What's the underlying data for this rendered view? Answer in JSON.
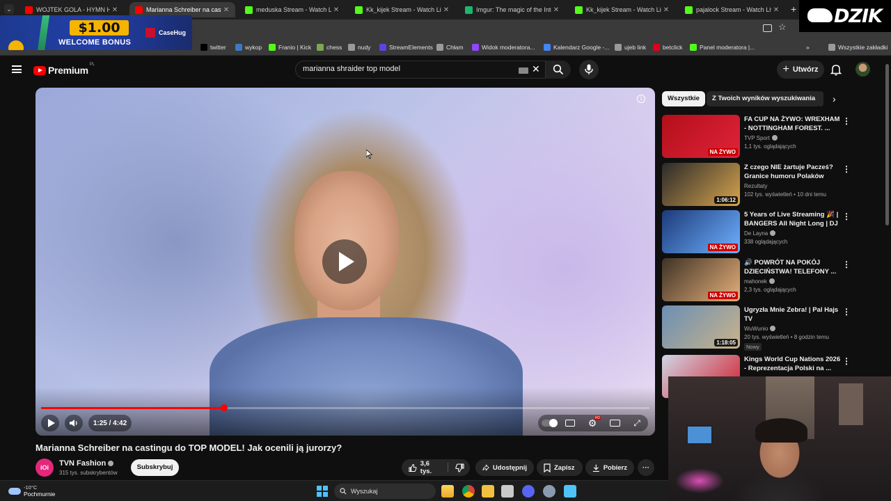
{
  "browser": {
    "tabs": [
      {
        "title": "WOJTEK GOLA - HYMN HETERO",
        "color": "#ff0000"
      },
      {
        "title": "Marianna Schreiber na castingu",
        "color": "#ff0000",
        "active": true
      },
      {
        "title": "meduska Stream - Watch Live on",
        "color": "#53fc18"
      },
      {
        "title": "Kk_kijek Stream - Watch Live on",
        "color": "#53fc18"
      },
      {
        "title": "Imgur: The magic of the Internet",
        "color": "#1bb76e"
      },
      {
        "title": "Kk_kijek Stream - Watch Live on",
        "color": "#53fc18"
      },
      {
        "title": "pajalock Stream - Watch Live on",
        "color": "#53fc18"
      }
    ],
    "new_tab_label": "+",
    "bookmarks": [
      {
        "label": "twitter",
        "icon": "x-icon",
        "color": "#000000"
      },
      {
        "label": "wykop",
        "icon": "wykop-icon",
        "color": "#3b7ac2"
      },
      {
        "label": "Franio | Kick",
        "icon": "kick-icon",
        "color": "#53fc18"
      },
      {
        "label": "chess",
        "icon": "chess-icon",
        "color": "#7fa650"
      },
      {
        "label": "nudy",
        "icon": "folder-icon",
        "color": "#9a9a9a"
      },
      {
        "label": "StreamElements",
        "icon": "streamelements-icon",
        "color": "#5945e2"
      },
      {
        "label": "Chłam",
        "icon": "globe-icon",
        "color": "#9a9a9a"
      },
      {
        "label": "Widok moderatora...",
        "icon": "twitch-icon",
        "color": "#9146ff"
      },
      {
        "label": "Kalendarz Google -...",
        "icon": "calendar-icon",
        "color": "#4285f4"
      },
      {
        "label": "ujeb link",
        "icon": "globe-icon",
        "color": "#9a9a9a"
      },
      {
        "label": "betclick",
        "icon": "betclic-icon",
        "color": "#e10019"
      },
      {
        "label": "Panel moderatora |...",
        "icon": "kick-icon",
        "color": "#53fc18"
      }
    ],
    "bookmarks_more": "»",
    "all_bookmarks": "Wszystkie zakładki"
  },
  "ad": {
    "amount": "$1.00",
    "text": "WELCOME BONUS",
    "brand": "CaseHug"
  },
  "overlay_logo": "DZIK",
  "youtube": {
    "logo_text": "Premium",
    "logo_region": "PL",
    "search_value": "marianna shraider top model",
    "create_label": "Utwórz",
    "video": {
      "title": "Marianna Schreiber na castingu do TOP MODEL! Jak ocenili ją jurorzy?",
      "time": "1:25 / 4:42",
      "progress": 0.301,
      "channel": "TVN Fashion",
      "channel_avatar": "iOi",
      "subscribers": "315 tys. subskrybentów",
      "subscribe_label": "Subskrybuj",
      "likes": "3,6 tys.",
      "share_label": "Udostępnij",
      "save_label": "Zapisz",
      "download_label": "Pobierz",
      "more_label": "···"
    },
    "chips": [
      "Wszystkie",
      "Z Twoich wyników wyszukiwania",
      "Z"
    ],
    "recommendations": [
      {
        "title": "FA CUP NA ŻYWO: WREXHAM - NOTTINGHAM FOREST. ...",
        "channel": "TVP Sport",
        "verified": true,
        "meta": "1,1 tys. oglądających",
        "badge": "NA ŻYWO",
        "live": true,
        "thumb": [
          "#b30f1a",
          "#e0233a"
        ]
      },
      {
        "title": "Z czego NIE żartuje Pacześ? Granice humoru Polaków",
        "channel": "Rezultaty",
        "verified": false,
        "meta": "102 tys. wyświetleń • 10 dni temu",
        "badge": "1:06:12",
        "live": false,
        "thumb": [
          "#2a2a2a",
          "#d8a44e"
        ]
      },
      {
        "title": "5 Years of Live Streaming 🎉 | BANGERS All Night Long | DJ ...",
        "channel": "De Layna",
        "verified": true,
        "meta": "338 oglądających",
        "badge": "NA ŻYWO",
        "live": true,
        "thumb": [
          "#1c3a7a",
          "#6fb1ff"
        ]
      },
      {
        "title": "🔊 POWRÓT NA POKÓJ DZIECIŃSTWA! TELEFONY ...",
        "channel": "mahonek",
        "verified": true,
        "meta": "2,3 tys. oglądających",
        "badge": "NA ŻYWO",
        "live": true,
        "thumb": [
          "#3e3226",
          "#e6b07a"
        ]
      },
      {
        "title": "Ugryzła Mnie Zebra! | Pal Hajs TV",
        "channel": "WuWunio",
        "verified": true,
        "meta": "20 tys. wyświetleń • 8 godzin temu",
        "badge": "1:18:05",
        "live": false,
        "nowy": "Nowy",
        "thumb": [
          "#6b8fb5",
          "#c9b38a"
        ]
      },
      {
        "title": "Kings World Cup Nations 2026 - Reprezentacja Polski na ...",
        "channel": "",
        "verified": false,
        "meta": "",
        "badge": "",
        "live": false,
        "thumb": [
          "#cfd6e6",
          "#d21d2a"
        ]
      }
    ]
  },
  "taskbar": {
    "temp": "-10°C",
    "weather": "Pochmurnie",
    "search_placeholder": "Wyszukaj"
  },
  "colors": {
    "accent_red": "#ff0000",
    "background": "#0f0f0f"
  }
}
